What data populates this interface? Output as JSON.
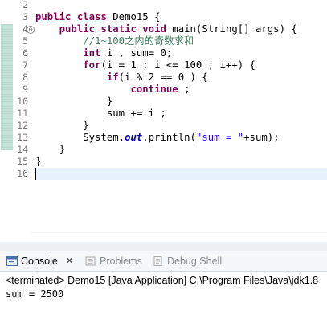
{
  "editor": {
    "line_numbers": [
      "2",
      "3",
      "4",
      "5",
      "6",
      "7",
      "8",
      "9",
      "10",
      "11",
      "12",
      "13",
      "14",
      "15",
      "16"
    ],
    "fold_marker": "⊖",
    "lines": [
      [],
      [
        {
          "t": "public",
          "c": "kw"
        },
        {
          "t": " "
        },
        {
          "t": "class",
          "c": "kw"
        },
        {
          "t": " Demo15 {"
        }
      ],
      [
        {
          "t": "    "
        },
        {
          "t": "public",
          "c": "kw"
        },
        {
          "t": " "
        },
        {
          "t": "static",
          "c": "kw"
        },
        {
          "t": " "
        },
        {
          "t": "void",
          "c": "kw"
        },
        {
          "t": " main(String[] args) {"
        }
      ],
      [
        {
          "t": "        "
        },
        {
          "t": "//1~100之内的奇数求和",
          "c": "cm"
        }
      ],
      [
        {
          "t": "        "
        },
        {
          "t": "int",
          "c": "kw"
        },
        {
          "t": " i , sum= 0;"
        }
      ],
      [
        {
          "t": "        "
        },
        {
          "t": "for",
          "c": "kw"
        },
        {
          "t": "(i = 1 ; i <= 100 ; i++) {"
        }
      ],
      [
        {
          "t": "            "
        },
        {
          "t": "if",
          "c": "kw"
        },
        {
          "t": "(i % 2 == 0 ) {"
        }
      ],
      [
        {
          "t": "                "
        },
        {
          "t": "continue",
          "c": "kw"
        },
        {
          "t": " ;"
        }
      ],
      [
        {
          "t": "            }"
        }
      ],
      [
        {
          "t": "            sum += i ;"
        }
      ],
      [
        {
          "t": "        }"
        }
      ],
      [
        {
          "t": "        System."
        },
        {
          "t": "out",
          "c": "fld"
        },
        {
          "t": ".println("
        },
        {
          "t": "\"sum = \"",
          "c": "str"
        },
        {
          "t": "+sum);"
        }
      ],
      [
        {
          "t": "    }"
        }
      ],
      [
        {
          "t": "}"
        }
      ],
      []
    ]
  },
  "console": {
    "tabs": [
      {
        "label": "Console",
        "icon": "console-icon",
        "active": true,
        "close": "✕"
      },
      {
        "label": "Problems",
        "icon": "problems-icon",
        "active": false
      },
      {
        "label": "Debug Shell",
        "icon": "debug-shell-icon",
        "active": false
      }
    ],
    "status_line": "<terminated> Demo15 [Java Application] C:\\Program Files\\Java\\jdk1.8",
    "output_lines": [
      "sum = 2500"
    ]
  }
}
